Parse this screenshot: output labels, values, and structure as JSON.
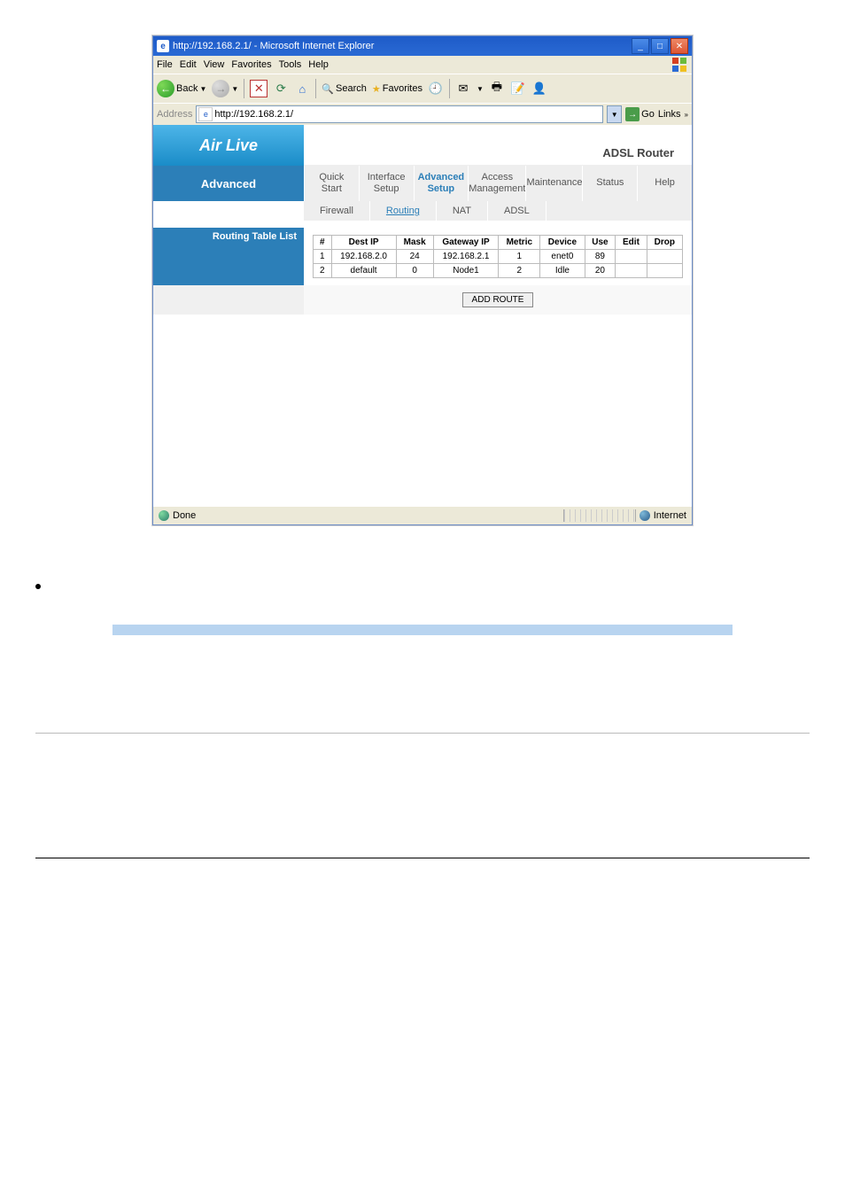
{
  "titlebar": {
    "title": "http://192.168.2.1/ - Microsoft Internet Explorer"
  },
  "menu": {
    "items": [
      "File",
      "Edit",
      "View",
      "Favorites",
      "Tools",
      "Help"
    ]
  },
  "toolbar": {
    "back": "Back",
    "search": "Search",
    "favorites": "Favorites"
  },
  "address": {
    "label": "Address",
    "url": "http://192.168.2.1/",
    "go": "Go",
    "links": "Links"
  },
  "router": {
    "logo": "Air Live",
    "product": "ADSL Router",
    "leftnav": "Advanced",
    "tabs": [
      {
        "l1": "Quick",
        "l2": "Start"
      },
      {
        "l1": "Interface",
        "l2": "Setup"
      },
      {
        "l1": "Advanced",
        "l2": "Setup"
      },
      {
        "l1": "Access",
        "l2": "Management"
      },
      {
        "l1": "Maintenance",
        "l2": ""
      },
      {
        "l1": "Status",
        "l2": ""
      },
      {
        "l1": "Help",
        "l2": ""
      }
    ],
    "subtabs": [
      "Firewall",
      "Routing",
      "NAT",
      "ADSL"
    ],
    "section": "Routing Table List",
    "headers": [
      "#",
      "Dest IP",
      "Mask",
      "Gateway IP",
      "Metric",
      "Device",
      "Use",
      "Edit",
      "Drop"
    ],
    "rows": [
      [
        "1",
        "192.168.2.0",
        "24",
        "192.168.2.1",
        "1",
        "enet0",
        "89",
        "",
        ""
      ],
      [
        "2",
        "default",
        "0",
        "Node1",
        "2",
        "Idle",
        "20",
        "",
        ""
      ]
    ],
    "add_btn": "ADD ROUTE"
  },
  "status": {
    "done": "Done",
    "zone": "Internet"
  },
  "desc_headers": [
    "",
    ""
  ]
}
